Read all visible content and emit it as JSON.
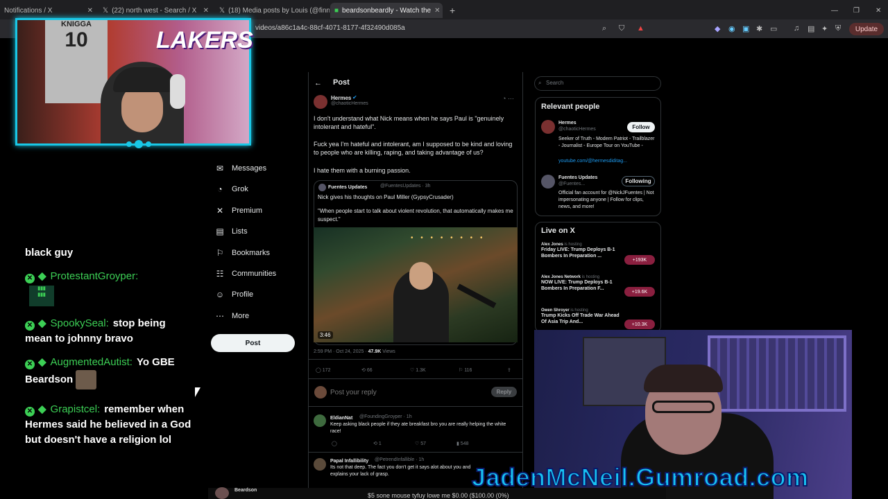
{
  "browser": {
    "tabs": [
      {
        "title": "Notifications / X"
      },
      {
        "title": "(22) north west - Search / X"
      },
      {
        "title": "(18) Media posts by Louis (@finnabu"
      },
      {
        "title": "beardsonbeardly - Watch the"
      }
    ],
    "url": "videos/a86c1a4c-88cf-4071-8177-4f32490d085a",
    "update_label": "Update"
  },
  "cam1": {
    "jersey_name": "KNIGGA",
    "jersey_number": "10",
    "banner": "LAKERS"
  },
  "chat": {
    "messages": [
      {
        "user": "",
        "text": "black guy"
      },
      {
        "user": "ProtestantGroyper:",
        "text": ""
      },
      {
        "user": "SpookySeal:",
        "text": "stop being mean to johnny bravo"
      },
      {
        "user": "AugmentedAutist:",
        "text": "Yo GBE Beardson"
      },
      {
        "user": "Grapistcel:",
        "text": "remember when Hermes said he believed in a God but doesn't have a religion lol"
      }
    ]
  },
  "xnav": {
    "items": [
      {
        "label": "Messages",
        "icon": "mail-icon"
      },
      {
        "label": "Grok",
        "icon": "grok-icon"
      },
      {
        "label": "Premium",
        "icon": "x-icon"
      },
      {
        "label": "Lists",
        "icon": "list-icon"
      },
      {
        "label": "Bookmarks",
        "icon": "bookmark-icon"
      },
      {
        "label": "Communities",
        "icon": "people-icon"
      },
      {
        "label": "Profile",
        "icon": "person-icon"
      },
      {
        "label": "More",
        "icon": "more-icon"
      }
    ],
    "post_button": "Post"
  },
  "post": {
    "header": "Post",
    "author": "Hermes",
    "handle": "@chaoticHermes",
    "text1": "I don't understand what Nick means when he says Paul is \"genuinely intolerant and hateful\".",
    "text2": "Fuck yea I'm hateful and intolerant, am I supposed to be kind and loving to people who are killing, raping, and taking advantage of us?",
    "text3": "I hate them with a burning passion.",
    "quote": {
      "author": "Fuentes Updates",
      "handle": "@FuentesUpdates · 3h",
      "line1": "Nick gives his thoughts on Paul Miller (GypsyCrusader)",
      "line2": "\"When people start to talk about violent revolution, that automatically makes me suspect.\"",
      "duration": "3:46"
    },
    "timestamp": "2:59 PM · Oct 24, 2025 ·",
    "views": "47.9K",
    "views_label": "Views",
    "stats": {
      "replies": "172",
      "reposts": "66",
      "likes": "1.3K",
      "bookmarks": "116"
    },
    "reply_placeholder": "Post your reply",
    "reply_button": "Reply",
    "replies": [
      {
        "author": "EldianNat",
        "handle": "@FoundingGroyper · 1h",
        "text": "Keep asking black people if they ate breakfast bro you are really helping the white race!",
        "likes": "57",
        "views": "548",
        "reposts": "1"
      },
      {
        "author": "Papal Infallibility",
        "handle": "@PetrendInfallible · 1h",
        "text": "Its not that deep. The fact you don't get it says alot about you and explains your lack of grasp."
      }
    ]
  },
  "right": {
    "search_placeholder": "Search",
    "relevant_title": "Relevant people",
    "people": [
      {
        "name": "Hermes",
        "handle": "@chaoticHermes",
        "bio": "Seeker of Truth - Modern Patriot - Trailblazer - Journalist - Europe Tour on YouTube -",
        "link": "youtube.com/@hermesdiditag...",
        "button": "Follow"
      },
      {
        "name": "Fuentes Updates",
        "handle": "@Fuentes...",
        "bio": "Official fan account for @NickJFuentes | Not impersonating anyone | Follow for clips, news, and more!",
        "button": "Following"
      }
    ],
    "live_title": "Live on X",
    "live": [
      {
        "host": "Alex Jones",
        "status": "is hosting",
        "title": "Friday LIVE: Trump Deploys B-1 Bombers In Preparation ...",
        "count": "+193K"
      },
      {
        "host": "Alex Jones Network",
        "status": "is hosting",
        "title": "NOW LIVE: Trump Deploys B-1 Bombers In Preparation F...",
        "count": "+19.6K"
      },
      {
        "host": "Owen Shroyer",
        "status": "is hosting",
        "title": "Trump Kicks Off Trade War Ahead Of Asia Trip And...",
        "count": "+10.3K"
      }
    ]
  },
  "overlay": {
    "gumroad": "JadenMcNeil.Gumroad.com",
    "ticker_user": "Beardson",
    "ticker_text": "$5 sone mouse tyfuy lowe me $0.00 ($100.00 (0%)"
  }
}
